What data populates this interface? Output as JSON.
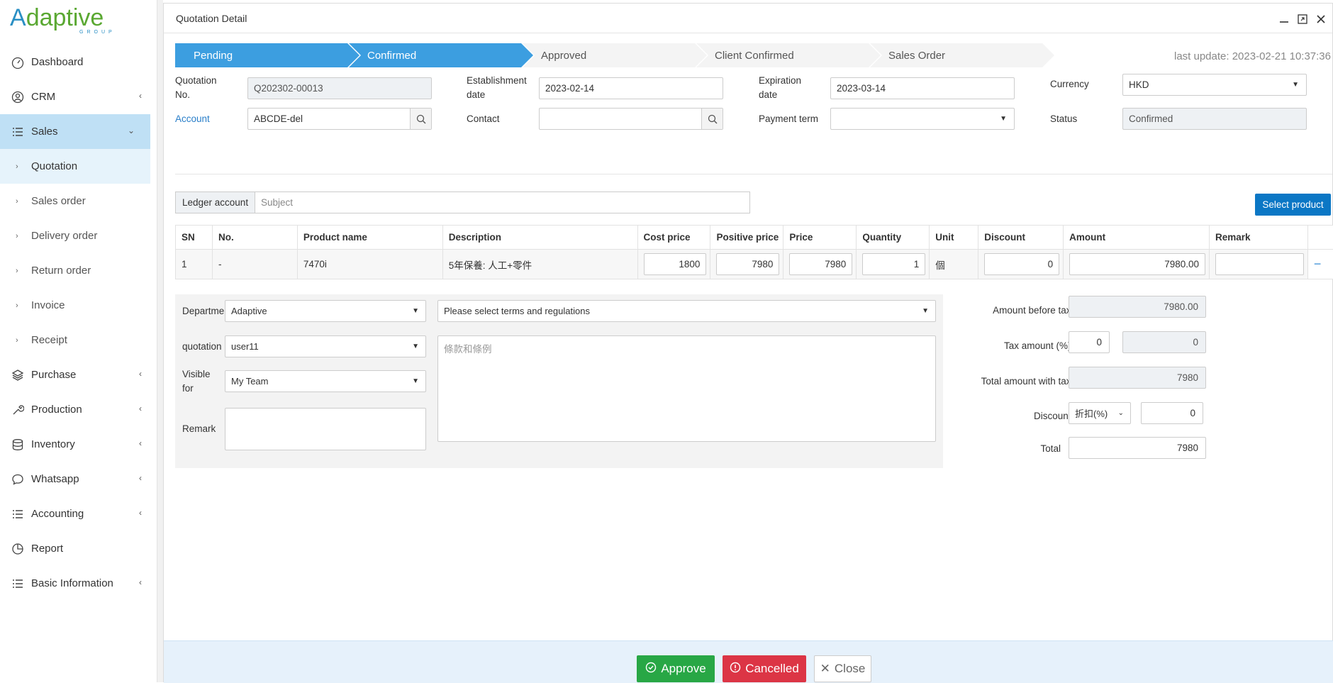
{
  "brand": {
    "logo_main_a": "A",
    "logo_main_rest": "daptive",
    "logo_sub": "GROUP"
  },
  "sidebar": {
    "items": [
      {
        "label": "Dashboard",
        "icon": "dashboard-icon"
      },
      {
        "label": "CRM",
        "icon": "user-circle-icon",
        "has_chevron": true
      },
      {
        "label": "Sales",
        "icon": "list-icon",
        "expanded": true
      },
      {
        "label": "Quotation",
        "sub": true,
        "selected": true
      },
      {
        "label": "Sales order",
        "sub": true
      },
      {
        "label": "Delivery order",
        "sub": true
      },
      {
        "label": "Return order",
        "sub": true
      },
      {
        "label": "Invoice",
        "sub": true
      },
      {
        "label": "Receipt",
        "sub": true
      },
      {
        "label": "Purchase",
        "icon": "layers-icon",
        "has_chevron": true
      },
      {
        "label": "Production",
        "icon": "wrench-icon",
        "has_chevron": true
      },
      {
        "label": "Inventory",
        "icon": "database-icon",
        "has_chevron": true
      },
      {
        "label": "Whatsapp",
        "icon": "chat-icon",
        "has_chevron": true
      },
      {
        "label": "Accounting",
        "icon": "list-icon",
        "has_chevron": true
      },
      {
        "label": "Report",
        "icon": "pie-chart-icon"
      },
      {
        "label": "Basic Information",
        "icon": "list-icon",
        "has_chevron": true
      }
    ]
  },
  "panel": {
    "title": "Quotation Detail",
    "steps": [
      "Pending",
      "Confirmed",
      "Approved",
      "Client Confirmed",
      "Sales Order"
    ],
    "active_steps": 2,
    "last_update": "last update: 2023-02-21 10:37:36"
  },
  "form": {
    "quotation_no_label_1": "Quotation",
    "quotation_no_label_2": "No.",
    "quotation_no": "Q202302-00013",
    "establishment_label_1": "Establishment",
    "establishment_label_2": "date",
    "establishment_date": "2023-02-14",
    "expiration_label_1": "Expiration",
    "expiration_label_2": "date",
    "expiration_date": "2023-03-14",
    "currency_label": "Currency",
    "currency": "HKD",
    "account_label": "Account",
    "account": "ABCDE-del",
    "contact_label": "Contact",
    "contact": "",
    "payment_term_label": "Payment term",
    "payment_term": "",
    "status_label": "Status",
    "status": "Confirmed"
  },
  "ledger": {
    "label": "Ledger account",
    "subject_placeholder": "Subject"
  },
  "select_product_label": "Select product",
  "table": {
    "headers": [
      "SN",
      "No.",
      "Product name",
      "Description",
      "Cost price",
      "Positive price",
      "Price",
      "Quantity",
      "Unit",
      "Discount",
      "Amount",
      "Remark",
      ""
    ],
    "rows": [
      {
        "sn": "1",
        "no": "-",
        "product": "7470i",
        "description": "5年保養: 人工+零件",
        "cost": "1800",
        "positive": "7980",
        "price": "7980",
        "qty": "1",
        "unit": "個",
        "discount": "0",
        "amount": "7980.00",
        "remark": ""
      }
    ]
  },
  "lower": {
    "department_label": "Departme",
    "department": "Adaptive",
    "terms_placeholder": "Please select terms and regulations",
    "quotation_label": "quotation",
    "quotation_user": "user11",
    "visible_label_1": "Visible",
    "visible_label_2": "for",
    "visible_for": "My Team",
    "remark_label": "Remark",
    "terms_text_placeholder": "條款和條例"
  },
  "totals": {
    "before_tax_label": "Amount before tax：",
    "before_tax": "7980.00",
    "tax_label": "Tax amount (%)：",
    "tax_percent": "0",
    "tax_amount": "0",
    "with_tax_label": "Total amount with tax：",
    "with_tax": "7980",
    "discount_label": "Discount：",
    "discount_type": "折扣(%)",
    "discount_value": "0",
    "total_label": "Total",
    "total": "7980"
  },
  "footer": {
    "approve": "Approve",
    "cancelled": "Cancelled",
    "close": "Close"
  }
}
